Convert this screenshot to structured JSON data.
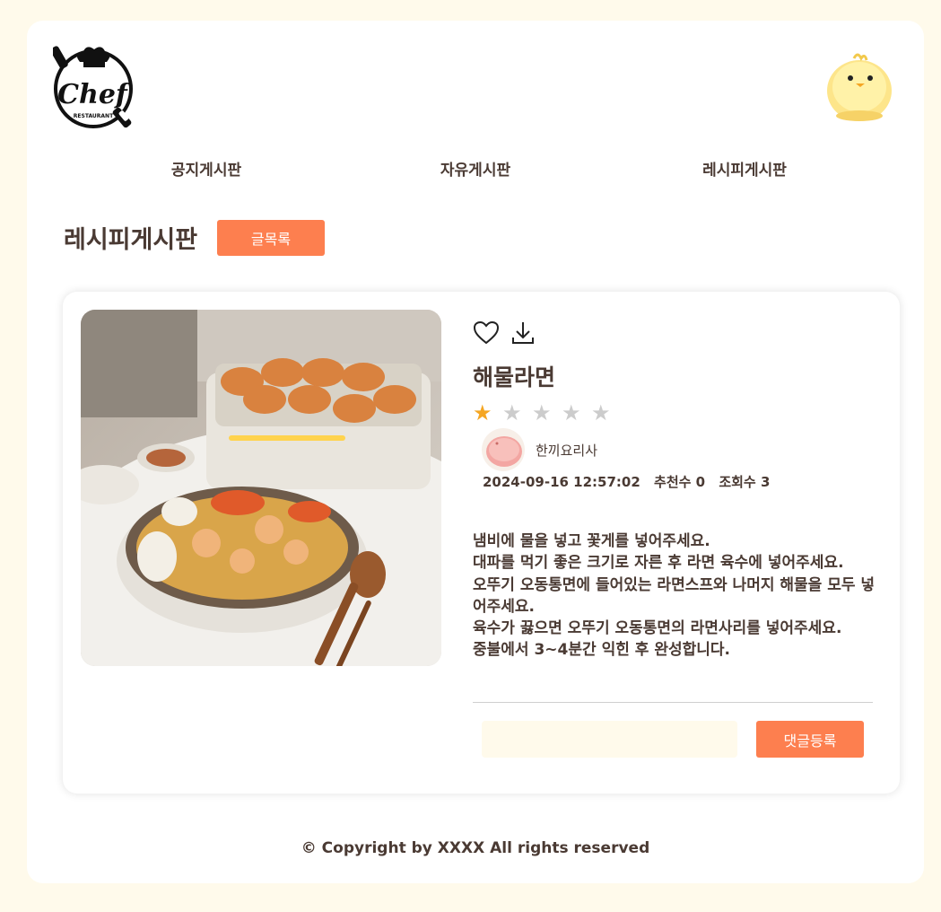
{
  "logo": {
    "brand_text": "Chef",
    "sub_text": "RESTAURANT"
  },
  "nav": {
    "items": [
      {
        "label": "공지게시판"
      },
      {
        "label": "자유게시판"
      },
      {
        "label": "레시피게시판"
      }
    ]
  },
  "board": {
    "title": "레시피게시판",
    "list_button": "글목록"
  },
  "post": {
    "title": "해물라면",
    "rating": 1,
    "rating_max": 5,
    "author": "한끼요리사",
    "datetime": "2024-09-16 12:57:02",
    "likes": "추천수 0",
    "views": "조회수 3",
    "description_lines": [
      "냄비에 물을 넣고 꽃게를 넣어주세요.",
      "대파를 먹기 좋은 크기로 자른 후 라면 육수에 넣어주세요.",
      "오뚜기 오동통면에 들어있는 라면스프와 나머지 해물을 모두 넣어주세요.",
      "육수가 끓으면 오뚜기 오동통면의 라면사리를 넣어주세요.",
      "중불에서 3~4분간 익힌 후 완성합니다."
    ]
  },
  "comment": {
    "placeholder": "",
    "submit_label": "댓글등록"
  },
  "footer": {
    "copyright": "© Copyright by XXXX All rights reserved"
  },
  "colors": {
    "accent": "#fd7f4f",
    "background": "#fffaeb",
    "text": "#4a3a33",
    "star_on": "#f5a623",
    "star_off": "#cccccc"
  },
  "icons": [
    "heart-icon",
    "download-icon"
  ]
}
